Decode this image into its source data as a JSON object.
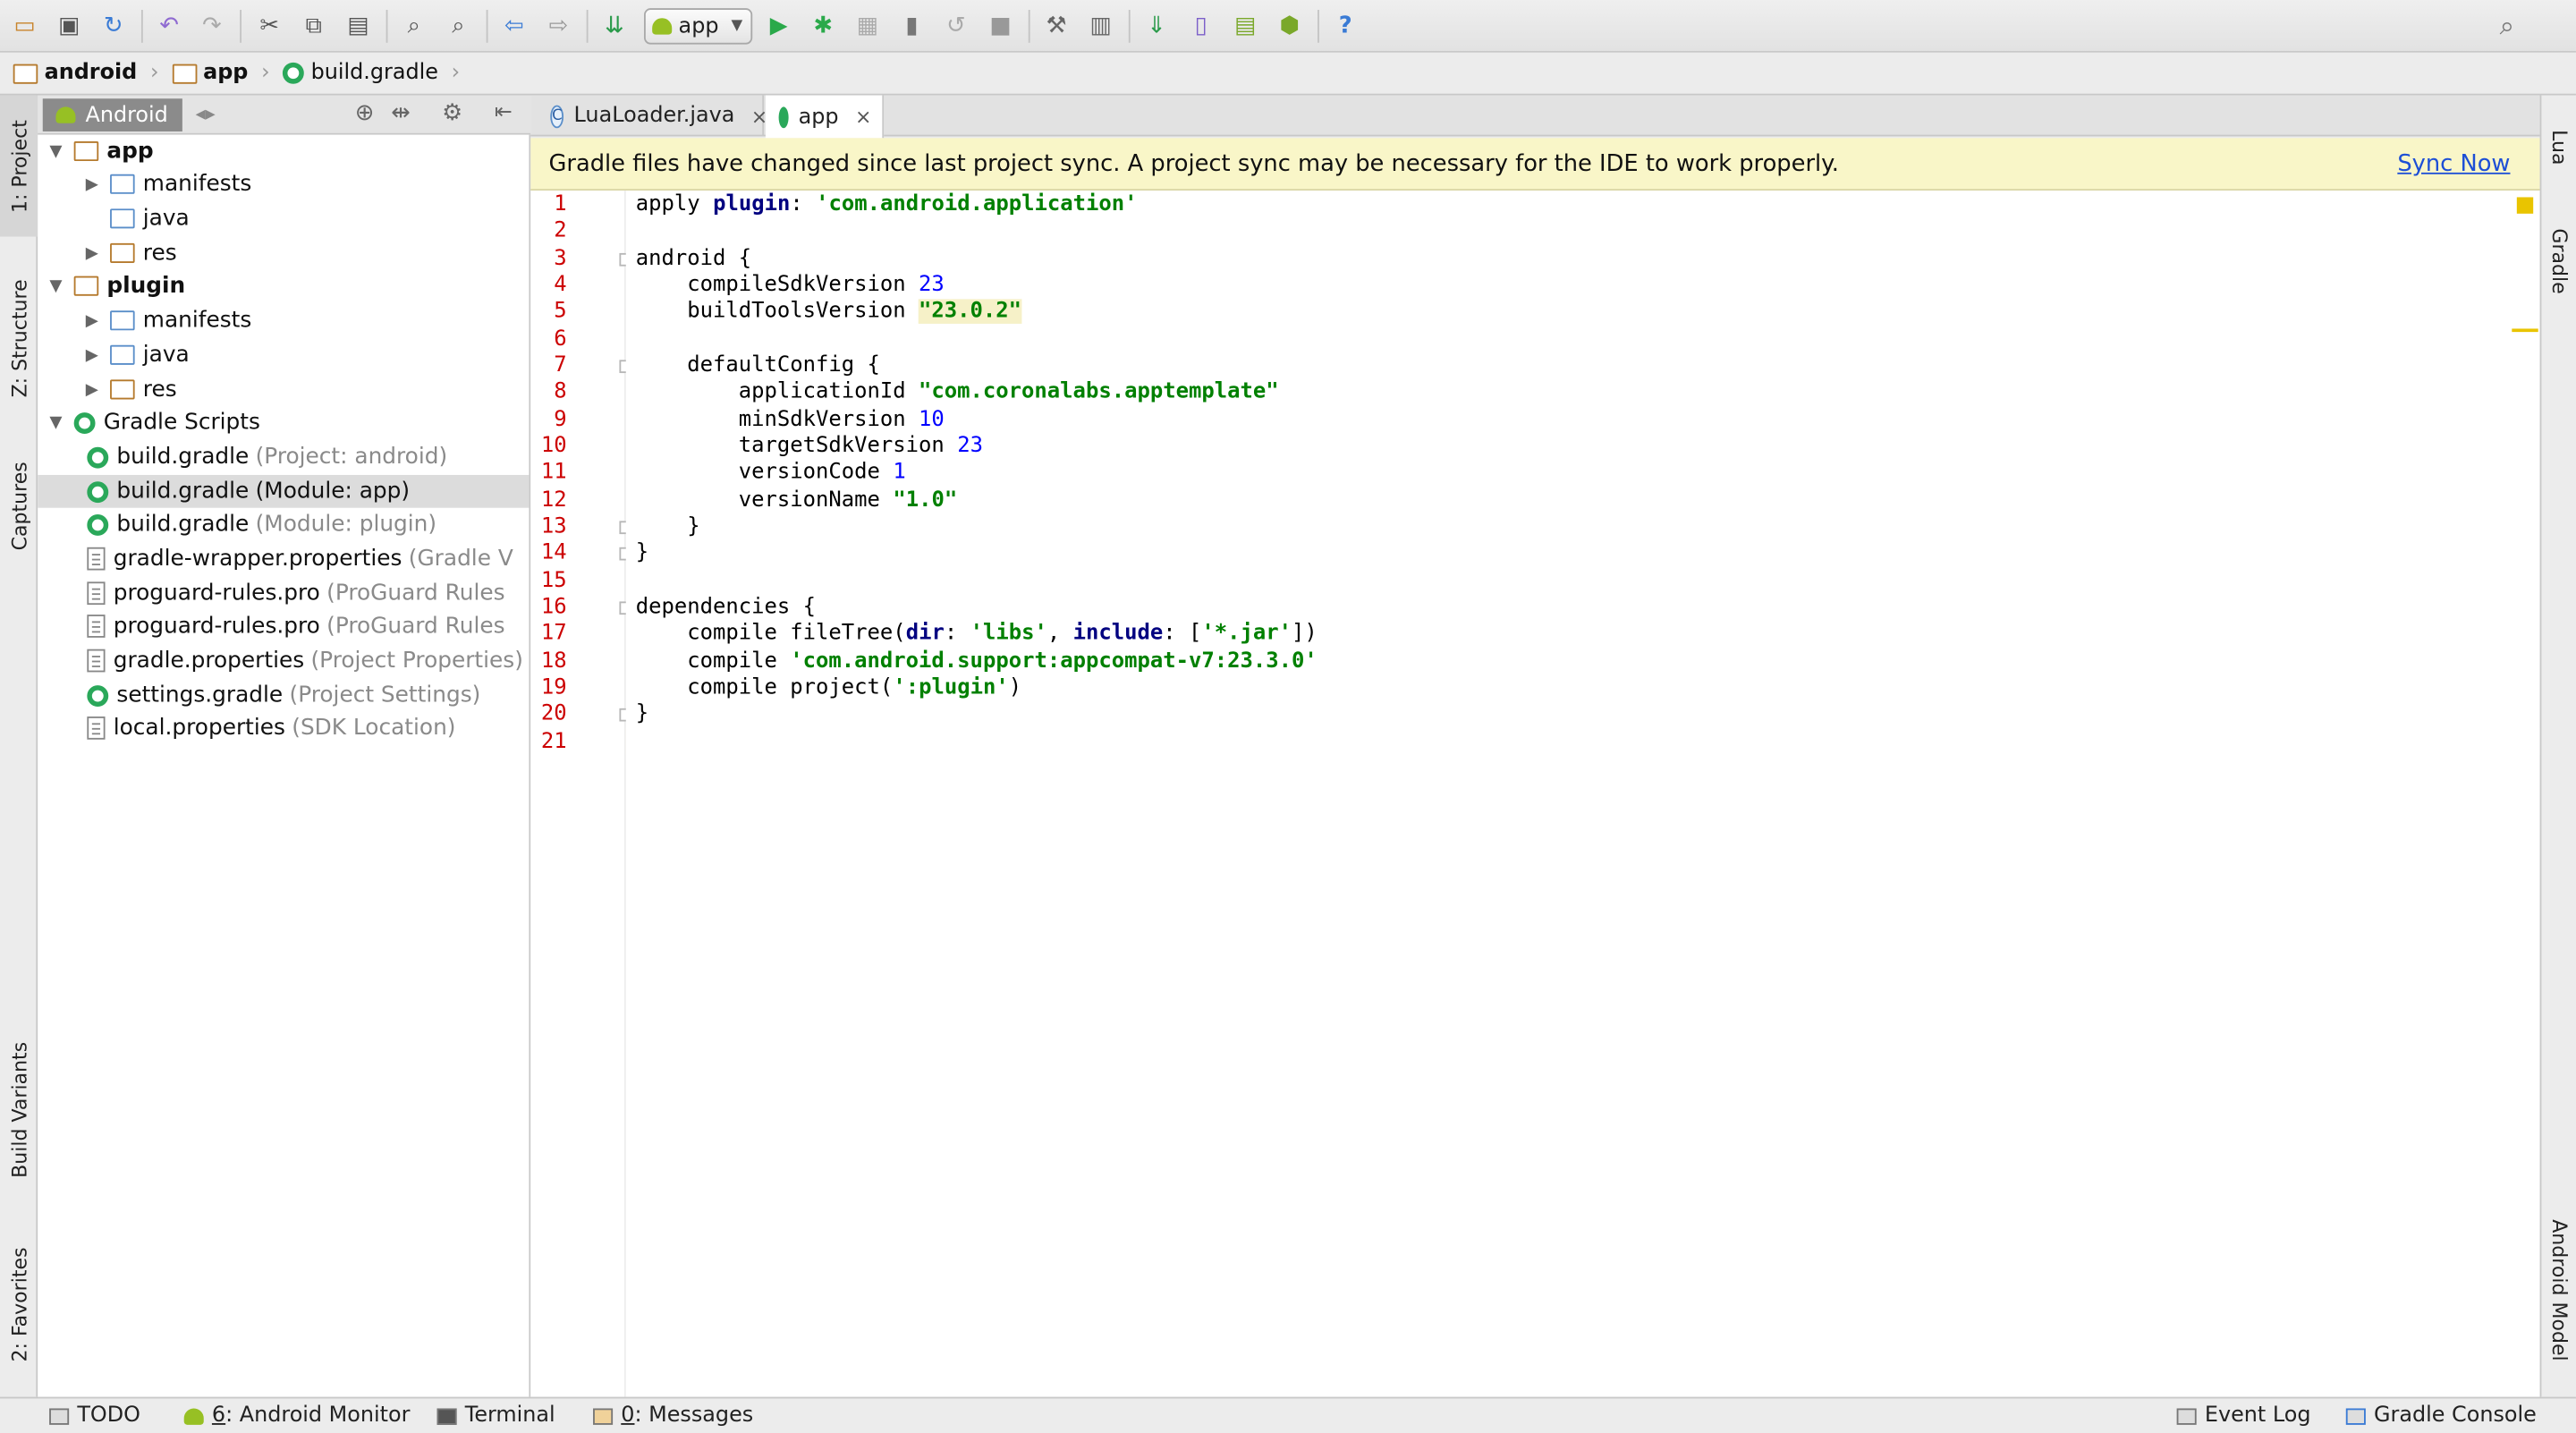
{
  "toolbar": {
    "run_config": "app",
    "icons": [
      "open-folder-icon",
      "save-icon",
      "sync-icon",
      "undo-icon",
      "redo-icon",
      "cut-icon",
      "copy-icon",
      "paste-icon",
      "find-icon",
      "replace-icon",
      "back-icon",
      "forward-icon",
      "make-project-icon",
      "run-icon",
      "debug-icon",
      "attach-debugger-icon",
      "apply-changes-icon",
      "rerun-icon",
      "stop-icon",
      "project-structure-icon",
      "sdk-manager-icon",
      "sync-gradle-icon",
      "avd-manager-icon",
      "android-device-monitor-icon",
      "android-icon",
      "help-icon",
      "search-everywhere-icon"
    ]
  },
  "navbar": {
    "crumbs": [
      "android",
      "app",
      "build.gradle"
    ]
  },
  "left_stripe": {
    "project": "1: Project",
    "structure": "Z: Structure",
    "captures": "Captures",
    "build_variants": "Build Variants",
    "favorites": "2: Favorites"
  },
  "right_stripe": {
    "lua": "Lua",
    "gradle": "Gradle",
    "android_model": "Android Model"
  },
  "project_panel": {
    "view_selector": "Android"
  },
  "tree": [
    {
      "label": "app",
      "hint": ""
    },
    {
      "label": "manifests",
      "hint": ""
    },
    {
      "label": "java",
      "hint": ""
    },
    {
      "label": "res",
      "hint": ""
    },
    {
      "label": "plugin",
      "hint": ""
    },
    {
      "label": "manifests",
      "hint": ""
    },
    {
      "label": "java",
      "hint": ""
    },
    {
      "label": "res",
      "hint": ""
    },
    {
      "label": "Gradle Scripts",
      "hint": ""
    },
    {
      "label": "build.gradle",
      "hint": "(Project: android)"
    },
    {
      "label": "build.gradle",
      "hint": "(Module: app)"
    },
    {
      "label": "build.gradle",
      "hint": "(Module: plugin)"
    },
    {
      "label": "gradle-wrapper.properties",
      "hint": "(Gradle V"
    },
    {
      "label": "proguard-rules.pro",
      "hint": "(ProGuard Rules"
    },
    {
      "label": "proguard-rules.pro",
      "hint": "(ProGuard Rules"
    },
    {
      "label": "gradle.properties",
      "hint": "(Project Properties)"
    },
    {
      "label": "settings.gradle",
      "hint": "(Project Settings)"
    },
    {
      "label": "local.properties",
      "hint": "(SDK Location)"
    }
  ],
  "tabs": [
    {
      "label": "LuaLoader.java",
      "close": "×"
    },
    {
      "label": "app",
      "close": "×"
    }
  ],
  "banner": {
    "message": "Gradle files have changed since last project sync. A project sync may be necessary for the IDE to work properly.",
    "action": "Sync Now"
  },
  "editor": {
    "line_numbers": [
      "1",
      "2",
      "3",
      "4",
      "5",
      "6",
      "7",
      "8",
      "9",
      "10",
      "11",
      "12",
      "13",
      "14",
      "15",
      "16",
      "17",
      "18",
      "19",
      "20",
      "21"
    ],
    "code": {
      "l1a": "apply ",
      "l1b": "plugin",
      "l1c": ": ",
      "l1d": "'com.android.application'",
      "l3": "android {",
      "l4a": "    compileSdkVersion ",
      "l4b": "23",
      "l5a": "    buildToolsVersion ",
      "l5b": "\"23.0.2\"",
      "l7": "    defaultConfig {",
      "l8a": "        applicationId ",
      "l8b": "\"com.coronalabs.apptemplate\"",
      "l9a": "        minSdkVersion ",
      "l9b": "10",
      "l10a": "        targetSdkVersion ",
      "l10b": "23",
      "l11a": "        versionCode ",
      "l11b": "1",
      "l12a": "        versionName ",
      "l12b": "\"1.0\"",
      "l13": "    }",
      "l14": "}",
      "l16": "dependencies {",
      "l17a": "    compile fileTree(",
      "l17b": "dir",
      "l17c": ": ",
      "l17d": "'libs'",
      "l17e": ", ",
      "l17f": "include",
      "l17g": ": [",
      "l17h": "'*.jar'",
      "l17i": "])",
      "l18a": "    compile ",
      "l18b": "'com.android.support:appcompat-v7:23.3.0'",
      "l19a": "    compile project(",
      "l19b": "':plugin'",
      "l19c": ")",
      "l20": "}"
    }
  },
  "statusbar": {
    "todo": "TODO",
    "android_monitor_key": "6",
    "android_monitor": ": Android Monitor",
    "terminal": "Terminal",
    "messages_key": "0",
    "messages": ": Messages",
    "event_log": "Event Log",
    "gradle_console": "Gradle Console"
  },
  "colors": {
    "keyword": "#000080",
    "string": "#008000",
    "number": "#0000ff",
    "line_number": "#cc0000",
    "banner_bg": "#f9f6c8",
    "link": "#1d4fd6"
  }
}
